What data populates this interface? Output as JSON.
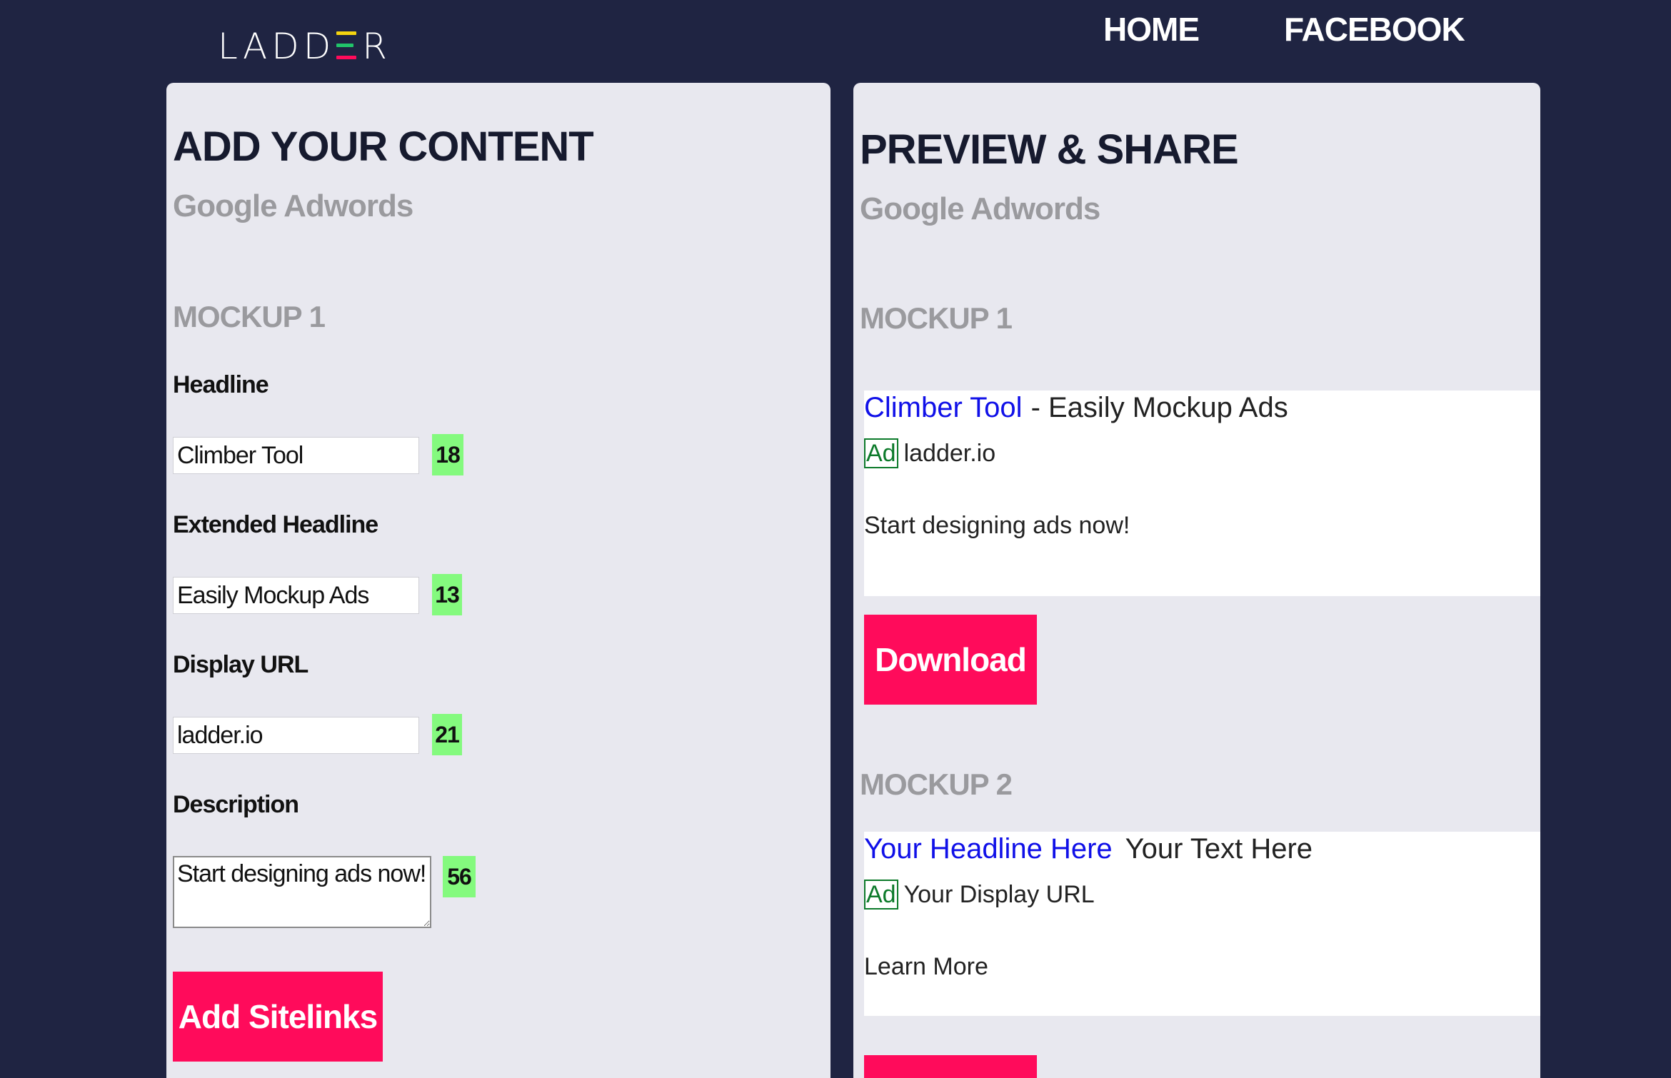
{
  "header": {
    "logo": "LADDER",
    "nav": [
      "HOME",
      "FACEBOOK"
    ]
  },
  "editor": {
    "title": "ADD YOUR CONTENT",
    "subtitle": "Google Adwords",
    "mockup_heading": "MOCKUP 1",
    "fields": {
      "headline": {
        "label": "Headline",
        "value": "Climber Tool",
        "count": "18"
      },
      "extended_headline": {
        "label": "Extended Headline",
        "value": "Easily Mockup Ads",
        "count": "13"
      },
      "display_url": {
        "label": "Display URL",
        "value": "ladder.io",
        "count": "21"
      },
      "description": {
        "label": "Description",
        "value": "Start designing ads now!",
        "count": "56"
      }
    },
    "add_sitelinks_label": "Add Sitelinks"
  },
  "preview": {
    "title": "PREVIEW & SHARE",
    "subtitle": "Google Adwords",
    "mockups": [
      {
        "heading": "MOCKUP 1",
        "headline": "Climber Tool",
        "extended": "- Easily Mockup Ads",
        "badge": "Ad",
        "url": "ladder.io",
        "description": "Start designing ads now!",
        "download_label": "Download"
      },
      {
        "heading": "MOCKUP 2",
        "headline": "Your Headline Here",
        "extended": "Your Text Here",
        "badge": "Ad",
        "url": "Your Display URL",
        "description": "Learn More"
      }
    ]
  },
  "colors": {
    "background": "#1f2442",
    "panel": "#e8e8ef",
    "accent": "#ff0b5b",
    "counter": "#84fa7e",
    "link_blue": "#1010e8",
    "ad_green": "#0c7a2a"
  }
}
